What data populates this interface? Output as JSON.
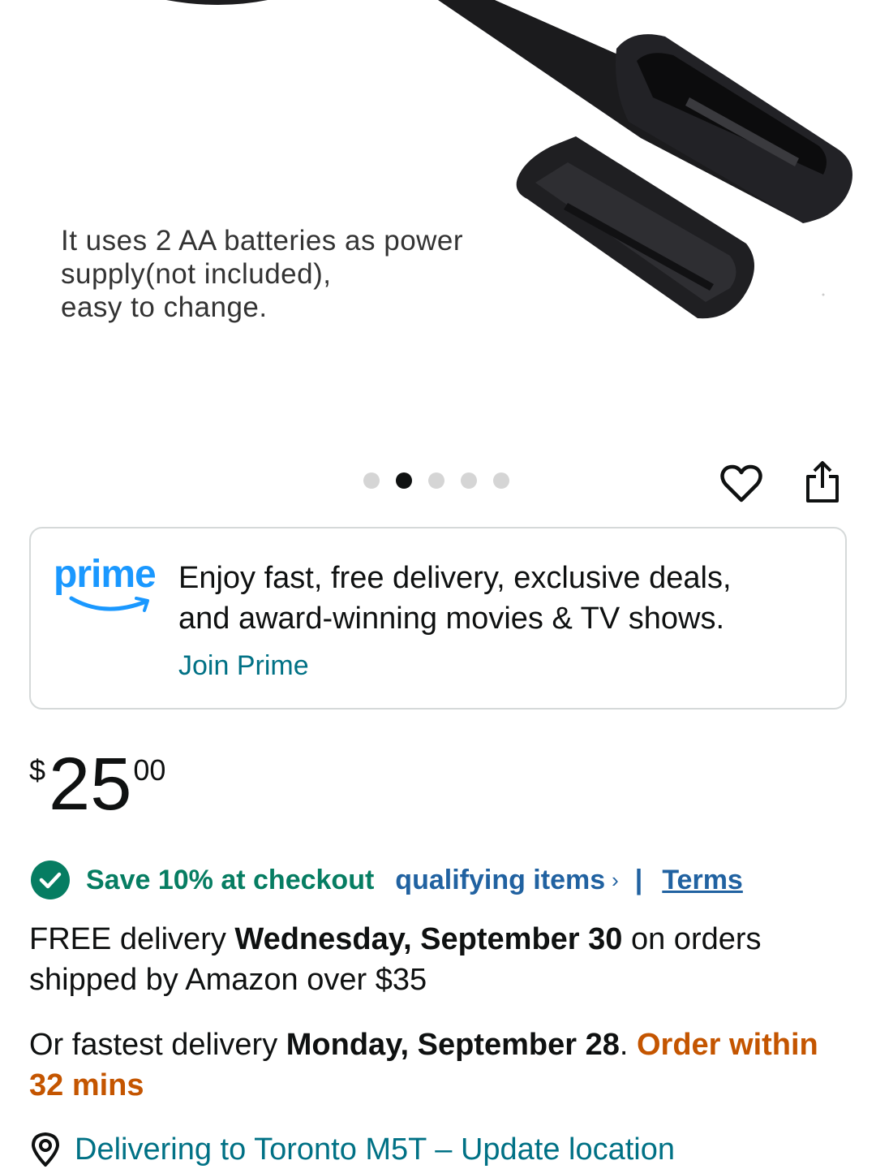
{
  "product_image": {
    "caption_lines": [
      "It uses 2 AA batteries as power",
      "supply(not included),",
      "easy to change."
    ]
  },
  "carousel": {
    "count": 5,
    "active_index": 1
  },
  "actions": {
    "wishlist_icon": "heart-icon",
    "share_icon": "share-icon"
  },
  "prime": {
    "logo_text": "prime",
    "line1": "Enjoy fast, free delivery, exclusive deals,",
    "line2": "and award-winning movies & TV shows.",
    "join_label": "Join Prime",
    "brand_color": "#1a98ff"
  },
  "price": {
    "symbol": "$",
    "whole": "25",
    "fraction": "00"
  },
  "promo": {
    "save_text": "Save 10% at checkout",
    "qualifying_label": "qualifying items",
    "chevron": "›",
    "separator": "|",
    "terms_label": "Terms",
    "icon": "check-circle-icon",
    "color": "#067d62"
  },
  "delivery": {
    "prefix": "FREE delivery ",
    "date": "Wednesday, September 30",
    "suffix": " on orders shipped by Amazon over $35"
  },
  "fastest": {
    "prefix": "Or fastest delivery ",
    "date": "Monday, September 28",
    "period": ". ",
    "countdown": "Order within 32 mins",
    "countdown_color": "#c45500"
  },
  "location": {
    "text": "Delivering to Toronto M5T – Update location",
    "icon": "location-pin-icon"
  }
}
